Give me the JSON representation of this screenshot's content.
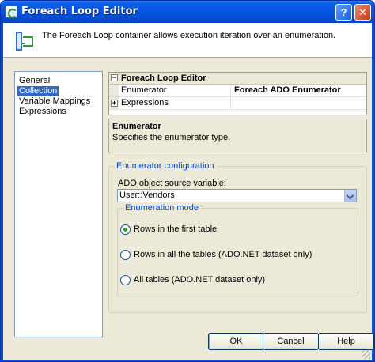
{
  "window": {
    "title": "Foreach Loop Editor",
    "help_glyph": "?",
    "close_glyph": "✕"
  },
  "header": {
    "description": "The Foreach Loop container allows execution iteration over an enumeration."
  },
  "nav": {
    "items": [
      {
        "label": "General",
        "selected": false
      },
      {
        "label": "Collection",
        "selected": true
      },
      {
        "label": "Variable Mappings",
        "selected": false
      },
      {
        "label": "Expressions",
        "selected": false
      }
    ]
  },
  "grid": {
    "category": "Foreach Loop Editor",
    "category_toggle": "−",
    "rows": [
      {
        "name": "Enumerator",
        "value": "Foreach ADO Enumerator"
      },
      {
        "name": "Expressions",
        "value": "",
        "toggle": "+"
      }
    ]
  },
  "description_panel": {
    "title": "Enumerator",
    "text": "Specifies the enumerator type."
  },
  "config": {
    "group_title": "Enumerator configuration",
    "source_label": "ADO object source variable:",
    "source_value": "User::Vendors",
    "mode_group_title": "Enumeration mode",
    "modes": [
      {
        "label": "Rows in the first table",
        "selected": true
      },
      {
        "label": "Rows in all the tables (ADO.NET dataset only)",
        "selected": false
      },
      {
        "label": "All tables (ADO.NET dataset only)",
        "selected": false
      }
    ]
  },
  "buttons": {
    "ok": "OK",
    "cancel": "Cancel",
    "help": "Help"
  },
  "colors": {
    "title_bar": "#0554e0",
    "dialog_bg": "#ece9d8",
    "selection": "#316ac5",
    "group_title": "#0046d5",
    "radio_selected": "#21a121"
  }
}
